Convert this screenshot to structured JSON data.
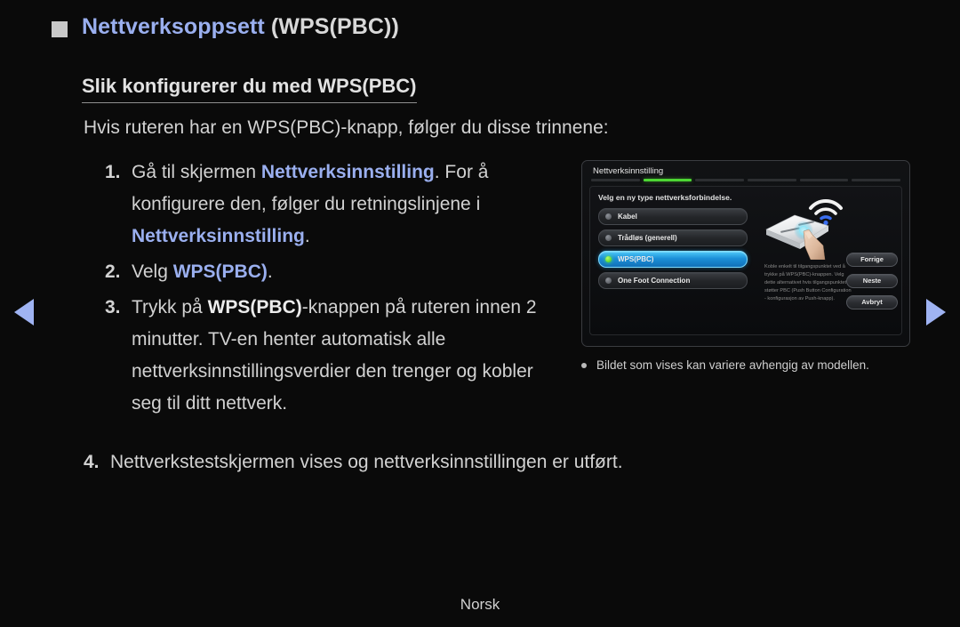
{
  "header": {
    "bullet": "square-bullet",
    "title_main": "Nettverksoppsett",
    "title_paren": "(WPS(PBC))"
  },
  "subtitle": "Slik konfigurerer du med WPS(PBC)",
  "intro": "Hvis ruteren har en WPS(PBC)-knapp, følger du disse trinnene:",
  "steps": [
    {
      "num": "1.",
      "parts": [
        {
          "text": "Gå til skjermen ",
          "style": "normal"
        },
        {
          "text": "Nettverksinnstilling",
          "style": "blue-bold"
        },
        {
          "text": ". For å konfigurere den, følger du retningslinjene i ",
          "style": "normal"
        },
        {
          "text": "Nettverksinnstilling",
          "style": "blue-bold"
        },
        {
          "text": ".",
          "style": "normal"
        }
      ]
    },
    {
      "num": "2.",
      "parts": [
        {
          "text": "Velg ",
          "style": "normal"
        },
        {
          "text": "WPS(PBC)",
          "style": "blue-bold"
        },
        {
          "text": ".",
          "style": "normal"
        }
      ]
    },
    {
      "num": "3.",
      "parts": [
        {
          "text": "Trykk på ",
          "style": "normal"
        },
        {
          "text": "WPS(PBC)",
          "style": "white-bold"
        },
        {
          "text": "-knappen på ruteren innen 2 minutter. TV-en henter automatisk alle nettverksinnstillingsverdier den trenger og kobler seg til ditt nettverk.",
          "style": "normal"
        }
      ]
    }
  ],
  "step4": {
    "num": "4.",
    "text": "Nettverkstestskjermen vises og nettverksinnstillingen er utført."
  },
  "nav": {
    "left_label": "previous-page-arrow",
    "right_label": "next-page-arrow"
  },
  "tv_panel": {
    "title": "Nettverksinnstilling",
    "progress_segments": 6,
    "progress_active_index": 1,
    "prompt": "Velg en ny type nettverksforbindelse.",
    "menu_items": [
      {
        "label": "Kabel",
        "selected": false
      },
      {
        "label": "Trådløs (generell)",
        "selected": false
      },
      {
        "label": "WPS(PBC)",
        "selected": true
      },
      {
        "label": "One Foot Connection",
        "selected": false
      }
    ],
    "description": "Koble enkelt til tilgangspunktet ved å trykke på WPS(PBC)-knappen. Velg dette alternativet hvis tilgangspunktet støtter PBC (Push Button Configuration - konfigurasjon av Push-knapp).",
    "buttons": [
      "Forrige",
      "Neste",
      "Avbryt"
    ],
    "illustration": "router-with-hand-pressing-button-and-wifi-waves"
  },
  "caption": "Bildet som vises kan variere avhengig av modellen.",
  "footer": "Norsk",
  "colors": {
    "background": "#0a0a0a",
    "accent_blue": "#9aafef",
    "text_primary": "#d2d2d2",
    "progress_green": "#4dd634",
    "selected_blue": "#1b8fd8"
  }
}
